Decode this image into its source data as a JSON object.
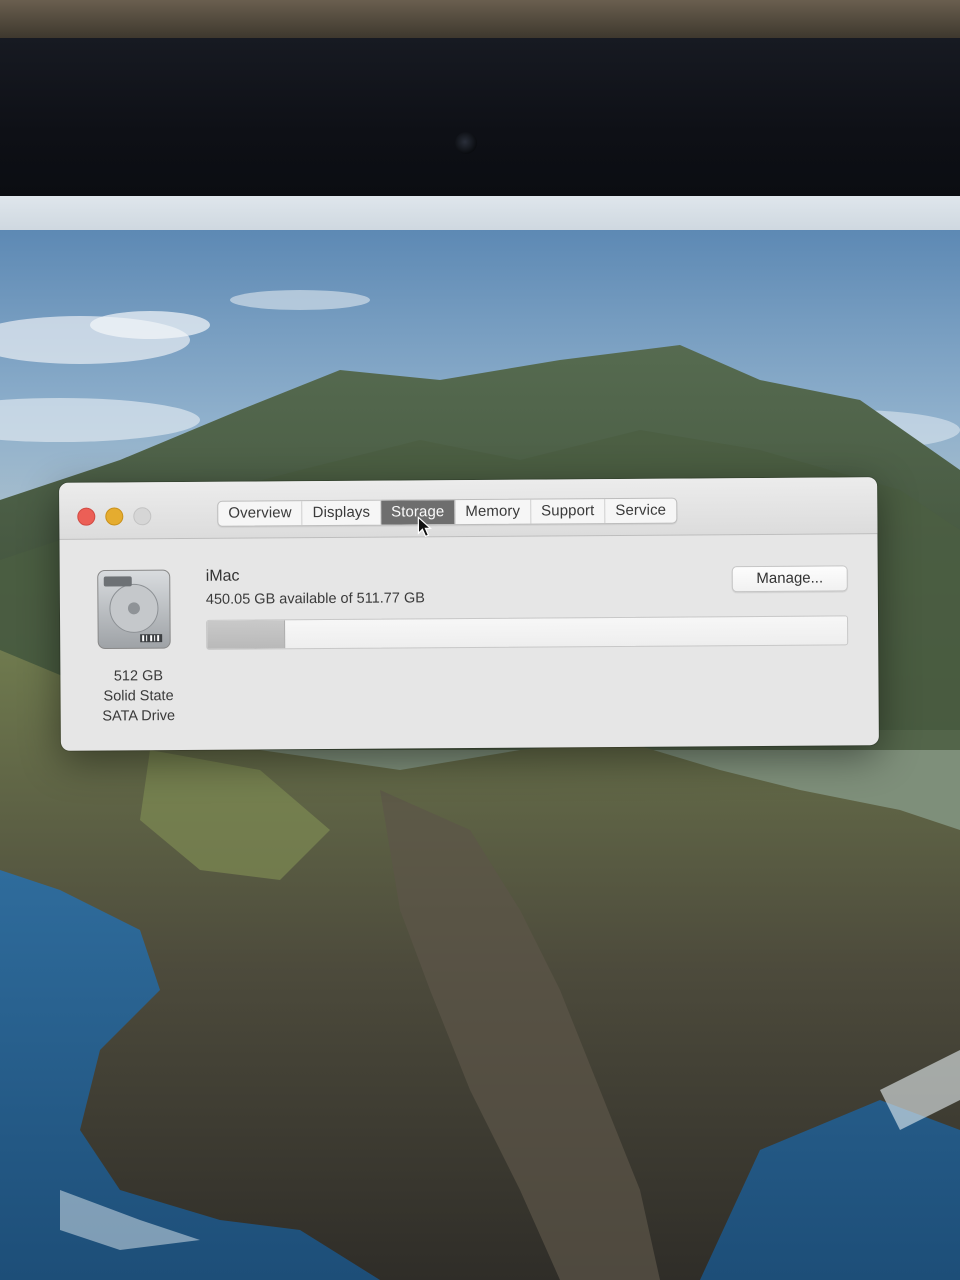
{
  "window": {
    "tabs": [
      {
        "label": "Overview"
      },
      {
        "label": "Displays"
      },
      {
        "label": "Storage",
        "selected": true
      },
      {
        "label": "Memory"
      },
      {
        "label": "Support"
      },
      {
        "label": "Service"
      }
    ]
  },
  "storage": {
    "device_name": "iMac",
    "availability": "450.05 GB available of 511.77 GB",
    "drive_lines": [
      "512 GB",
      "Solid State",
      "SATA Drive"
    ],
    "manage_label": "Manage...",
    "used_fraction": 0.12
  },
  "icons": {
    "drive": "hard-drive-icon",
    "cursor": "pointer-cursor-icon"
  },
  "colors": {
    "close": "#ec5f56",
    "minimize": "#e5ac2f",
    "selected_tab": "#6e6e6e"
  }
}
